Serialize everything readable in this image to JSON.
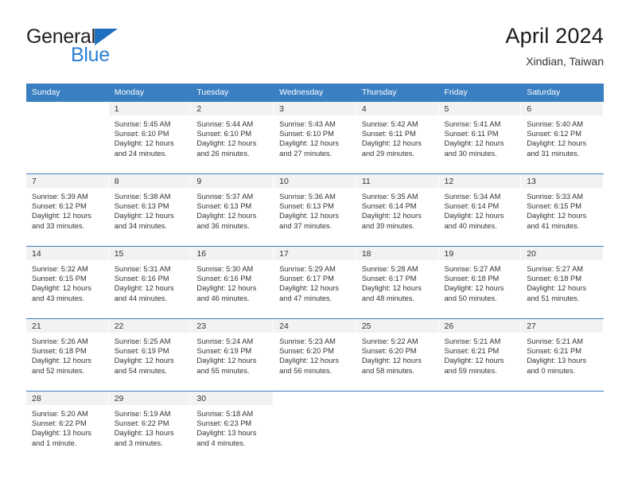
{
  "brand": {
    "name_part1": "General",
    "name_part2": "Blue",
    "accent_color": "#2b7fd4",
    "triangle_color": "#1f6fc0"
  },
  "header": {
    "title": "April 2024",
    "subtitle": "Xindian, Taiwan"
  },
  "calendar": {
    "header_bg": "#3a7fc1",
    "daynum_bg": "#f2f2f2",
    "weekdays": [
      "Sunday",
      "Monday",
      "Tuesday",
      "Wednesday",
      "Thursday",
      "Friday",
      "Saturday"
    ],
    "weeks": [
      [
        {
          "day": ""
        },
        {
          "day": "1",
          "sunrise": "Sunrise: 5:45 AM",
          "sunset": "Sunset: 6:10 PM",
          "daylight_line1": "Daylight: 12 hours",
          "daylight_line2": "and 24 minutes."
        },
        {
          "day": "2",
          "sunrise": "Sunrise: 5:44 AM",
          "sunset": "Sunset: 6:10 PM",
          "daylight_line1": "Daylight: 12 hours",
          "daylight_line2": "and 26 minutes."
        },
        {
          "day": "3",
          "sunrise": "Sunrise: 5:43 AM",
          "sunset": "Sunset: 6:10 PM",
          "daylight_line1": "Daylight: 12 hours",
          "daylight_line2": "and 27 minutes."
        },
        {
          "day": "4",
          "sunrise": "Sunrise: 5:42 AM",
          "sunset": "Sunset: 6:11 PM",
          "daylight_line1": "Daylight: 12 hours",
          "daylight_line2": "and 29 minutes."
        },
        {
          "day": "5",
          "sunrise": "Sunrise: 5:41 AM",
          "sunset": "Sunset: 6:11 PM",
          "daylight_line1": "Daylight: 12 hours",
          "daylight_line2": "and 30 minutes."
        },
        {
          "day": "6",
          "sunrise": "Sunrise: 5:40 AM",
          "sunset": "Sunset: 6:12 PM",
          "daylight_line1": "Daylight: 12 hours",
          "daylight_line2": "and 31 minutes."
        }
      ],
      [
        {
          "day": "7",
          "sunrise": "Sunrise: 5:39 AM",
          "sunset": "Sunset: 6:12 PM",
          "daylight_line1": "Daylight: 12 hours",
          "daylight_line2": "and 33 minutes."
        },
        {
          "day": "8",
          "sunrise": "Sunrise: 5:38 AM",
          "sunset": "Sunset: 6:13 PM",
          "daylight_line1": "Daylight: 12 hours",
          "daylight_line2": "and 34 minutes."
        },
        {
          "day": "9",
          "sunrise": "Sunrise: 5:37 AM",
          "sunset": "Sunset: 6:13 PM",
          "daylight_line1": "Daylight: 12 hours",
          "daylight_line2": "and 36 minutes."
        },
        {
          "day": "10",
          "sunrise": "Sunrise: 5:36 AM",
          "sunset": "Sunset: 6:13 PM",
          "daylight_line1": "Daylight: 12 hours",
          "daylight_line2": "and 37 minutes."
        },
        {
          "day": "11",
          "sunrise": "Sunrise: 5:35 AM",
          "sunset": "Sunset: 6:14 PM",
          "daylight_line1": "Daylight: 12 hours",
          "daylight_line2": "and 39 minutes."
        },
        {
          "day": "12",
          "sunrise": "Sunrise: 5:34 AM",
          "sunset": "Sunset: 6:14 PM",
          "daylight_line1": "Daylight: 12 hours",
          "daylight_line2": "and 40 minutes."
        },
        {
          "day": "13",
          "sunrise": "Sunrise: 5:33 AM",
          "sunset": "Sunset: 6:15 PM",
          "daylight_line1": "Daylight: 12 hours",
          "daylight_line2": "and 41 minutes."
        }
      ],
      [
        {
          "day": "14",
          "sunrise": "Sunrise: 5:32 AM",
          "sunset": "Sunset: 6:15 PM",
          "daylight_line1": "Daylight: 12 hours",
          "daylight_line2": "and 43 minutes."
        },
        {
          "day": "15",
          "sunrise": "Sunrise: 5:31 AM",
          "sunset": "Sunset: 6:16 PM",
          "daylight_line1": "Daylight: 12 hours",
          "daylight_line2": "and 44 minutes."
        },
        {
          "day": "16",
          "sunrise": "Sunrise: 5:30 AM",
          "sunset": "Sunset: 6:16 PM",
          "daylight_line1": "Daylight: 12 hours",
          "daylight_line2": "and 46 minutes."
        },
        {
          "day": "17",
          "sunrise": "Sunrise: 5:29 AM",
          "sunset": "Sunset: 6:17 PM",
          "daylight_line1": "Daylight: 12 hours",
          "daylight_line2": "and 47 minutes."
        },
        {
          "day": "18",
          "sunrise": "Sunrise: 5:28 AM",
          "sunset": "Sunset: 6:17 PM",
          "daylight_line1": "Daylight: 12 hours",
          "daylight_line2": "and 48 minutes."
        },
        {
          "day": "19",
          "sunrise": "Sunrise: 5:27 AM",
          "sunset": "Sunset: 6:18 PM",
          "daylight_line1": "Daylight: 12 hours",
          "daylight_line2": "and 50 minutes."
        },
        {
          "day": "20",
          "sunrise": "Sunrise: 5:27 AM",
          "sunset": "Sunset: 6:18 PM",
          "daylight_line1": "Daylight: 12 hours",
          "daylight_line2": "and 51 minutes."
        }
      ],
      [
        {
          "day": "21",
          "sunrise": "Sunrise: 5:26 AM",
          "sunset": "Sunset: 6:18 PM",
          "daylight_line1": "Daylight: 12 hours",
          "daylight_line2": "and 52 minutes."
        },
        {
          "day": "22",
          "sunrise": "Sunrise: 5:25 AM",
          "sunset": "Sunset: 6:19 PM",
          "daylight_line1": "Daylight: 12 hours",
          "daylight_line2": "and 54 minutes."
        },
        {
          "day": "23",
          "sunrise": "Sunrise: 5:24 AM",
          "sunset": "Sunset: 6:19 PM",
          "daylight_line1": "Daylight: 12 hours",
          "daylight_line2": "and 55 minutes."
        },
        {
          "day": "24",
          "sunrise": "Sunrise: 5:23 AM",
          "sunset": "Sunset: 6:20 PM",
          "daylight_line1": "Daylight: 12 hours",
          "daylight_line2": "and 56 minutes."
        },
        {
          "day": "25",
          "sunrise": "Sunrise: 5:22 AM",
          "sunset": "Sunset: 6:20 PM",
          "daylight_line1": "Daylight: 12 hours",
          "daylight_line2": "and 58 minutes."
        },
        {
          "day": "26",
          "sunrise": "Sunrise: 5:21 AM",
          "sunset": "Sunset: 6:21 PM",
          "daylight_line1": "Daylight: 12 hours",
          "daylight_line2": "and 59 minutes."
        },
        {
          "day": "27",
          "sunrise": "Sunrise: 5:21 AM",
          "sunset": "Sunset: 6:21 PM",
          "daylight_line1": "Daylight: 13 hours",
          "daylight_line2": "and 0 minutes."
        }
      ],
      [
        {
          "day": "28",
          "sunrise": "Sunrise: 5:20 AM",
          "sunset": "Sunset: 6:22 PM",
          "daylight_line1": "Daylight: 13 hours",
          "daylight_line2": "and 1 minute."
        },
        {
          "day": "29",
          "sunrise": "Sunrise: 5:19 AM",
          "sunset": "Sunset: 6:22 PM",
          "daylight_line1": "Daylight: 13 hours",
          "daylight_line2": "and 3 minutes."
        },
        {
          "day": "30",
          "sunrise": "Sunrise: 5:18 AM",
          "sunset": "Sunset: 6:23 PM",
          "daylight_line1": "Daylight: 13 hours",
          "daylight_line2": "and 4 minutes."
        },
        {
          "day": ""
        },
        {
          "day": ""
        },
        {
          "day": ""
        },
        {
          "day": ""
        }
      ]
    ]
  }
}
